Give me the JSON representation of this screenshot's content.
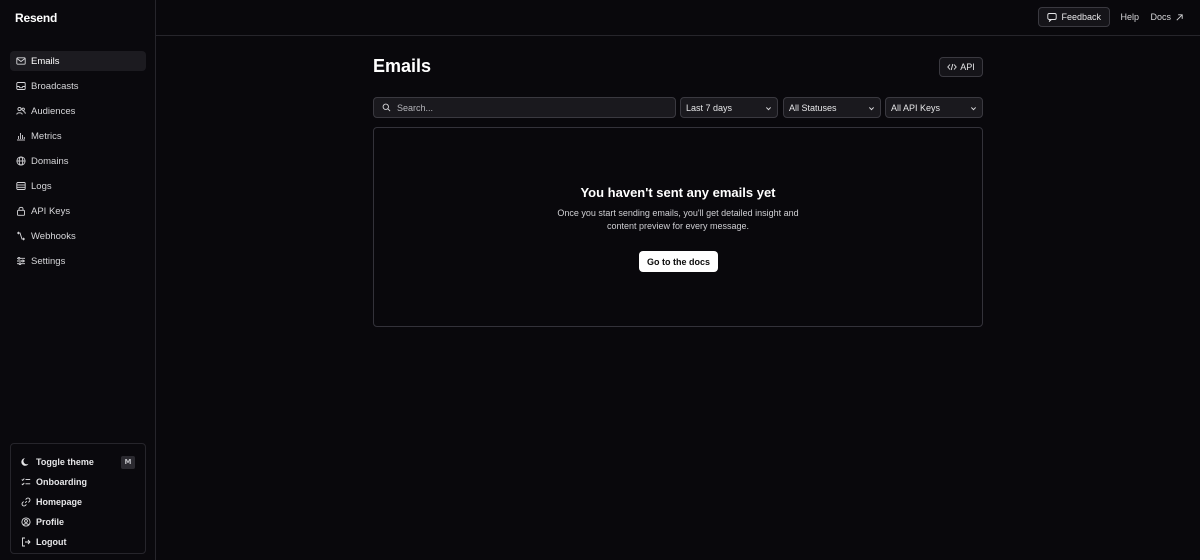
{
  "app": {
    "brand": "Resend"
  },
  "sidebar": {
    "items": [
      {
        "label": "Emails",
        "icon": "mail-icon",
        "active": true
      },
      {
        "label": "Broadcasts",
        "icon": "inbox-icon"
      },
      {
        "label": "Audiences",
        "icon": "users-icon"
      },
      {
        "label": "Metrics",
        "icon": "bar-chart-icon"
      },
      {
        "label": "Domains",
        "icon": "globe-icon"
      },
      {
        "label": "Logs",
        "icon": "list-icon"
      },
      {
        "label": "API Keys",
        "icon": "lock-icon"
      },
      {
        "label": "Webhooks",
        "icon": "webhook-icon"
      },
      {
        "label": "Settings",
        "icon": "sliders-icon"
      }
    ],
    "bottom": {
      "toggle_theme": "Toggle theme",
      "toggle_shortcut": "M",
      "onboarding": "Onboarding",
      "homepage": "Homepage",
      "profile": "Profile",
      "logout": "Logout"
    }
  },
  "topbar": {
    "feedback": "Feedback",
    "help": "Help",
    "docs": "Docs"
  },
  "main": {
    "title": "Emails",
    "api_button": "API",
    "search_placeholder": "Search...",
    "filters": {
      "date": "Last 7 days",
      "status": "All Statuses",
      "api_keys": "All API Keys"
    },
    "empty": {
      "title": "You haven't sent any emails yet",
      "desc_line1": "Once you start sending emails, you'll get detailed insight and",
      "desc_line2": "content preview for every message.",
      "button": "Go to the docs"
    }
  },
  "colors": {
    "background": "#09080c",
    "border": "#26252b",
    "active_item": "#1c1b20",
    "primary_button": "#ffffff"
  }
}
